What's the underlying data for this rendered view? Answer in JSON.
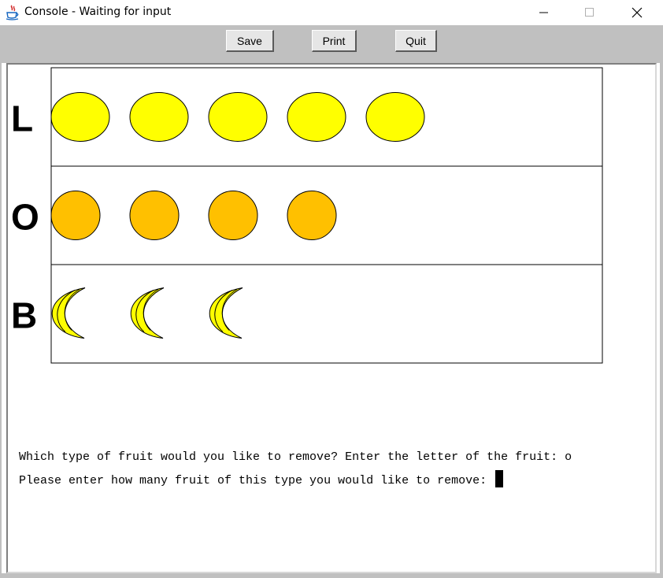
{
  "window": {
    "title": "Console - Waiting for input",
    "icon": "java-cup-icon",
    "controls": [
      "minimize-icon",
      "maximize-icon",
      "close-icon"
    ]
  },
  "toolbar": {
    "save_label": "Save",
    "print_label": "Print",
    "quit_label": "Quit"
  },
  "fruit_rows": [
    {
      "letter": "L",
      "fruit": "lemon",
      "count": 5,
      "color": "#ffff00"
    },
    {
      "letter": "O",
      "fruit": "orange",
      "count": 4,
      "color": "#ffc000"
    },
    {
      "letter": "B",
      "fruit": "banana",
      "count": 3,
      "color": "#ffff00"
    }
  ],
  "console": {
    "line1_prompt": "Which type of fruit would you like to remove? Enter the letter of the fruit: ",
    "line1_input": "o",
    "line2_prompt": "Please enter how many fruit of this type you would like to remove: "
  }
}
